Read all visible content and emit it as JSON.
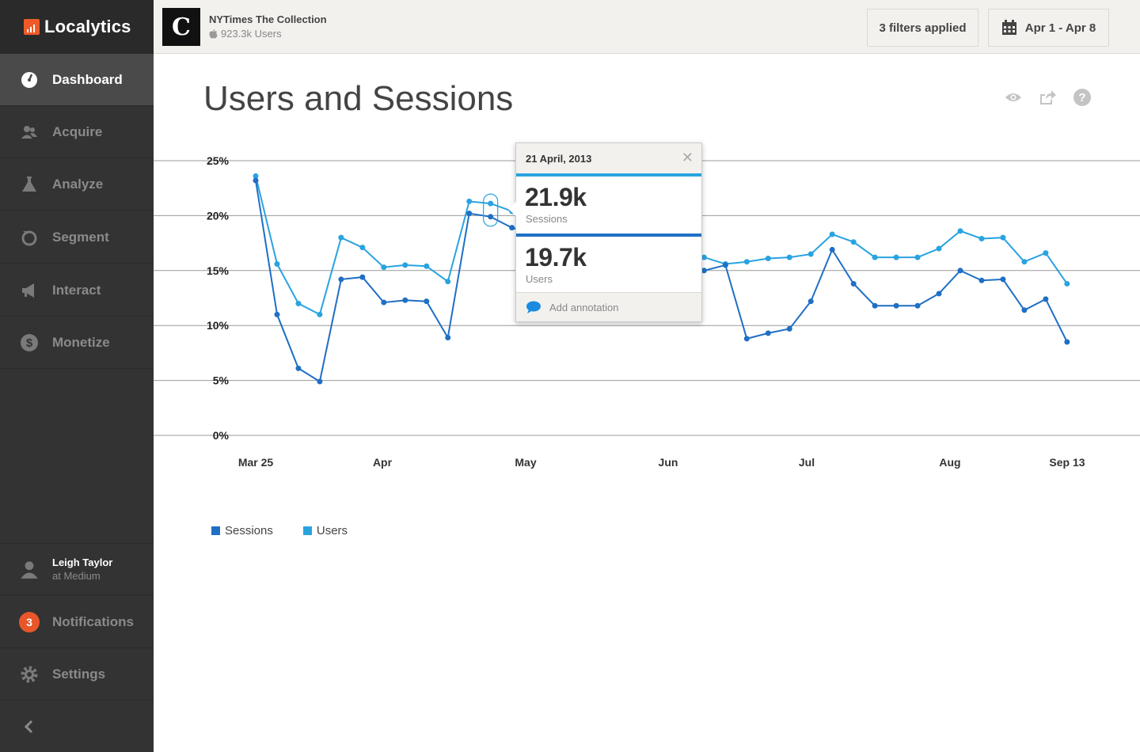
{
  "brand": {
    "name": "Localytics",
    "accent": "#f05a28"
  },
  "sidebar": {
    "items": [
      {
        "label": "Dashboard",
        "icon": "dashboard-gauge-icon",
        "active": true
      },
      {
        "label": "Acquire",
        "icon": "users-icon",
        "active": false
      },
      {
        "label": "Analyze",
        "icon": "flask-icon",
        "active": false
      },
      {
        "label": "Segment",
        "icon": "refresh-circle-icon",
        "active": false
      },
      {
        "label": "Interact",
        "icon": "megaphone-icon",
        "active": false
      },
      {
        "label": "Monetize",
        "icon": "dollar-icon",
        "active": false
      }
    ],
    "user": {
      "name": "Leigh Taylor",
      "org": "at Medium"
    },
    "notifications": {
      "label": "Notifications",
      "count": "3"
    },
    "settings": {
      "label": "Settings"
    },
    "collapse_icon": "chevron-left-icon"
  },
  "topbar": {
    "app_name": "NYTimes The Collection",
    "app_users": "923.3k Users",
    "platform_icon": "apple-icon",
    "filters_label": "3 filters applied",
    "date_range": "Apr 1 - Apr 8"
  },
  "main": {
    "title": "Users and Sessions",
    "header_icons": [
      "eye-icon",
      "share-icon",
      "help-icon"
    ]
  },
  "tooltip": {
    "date": "21 April, 2013",
    "sessions_value": "21.9k",
    "sessions_label": "Sessions",
    "users_value": "19.7k",
    "users_label": "Users",
    "annotation_label": "Add annotation"
  },
  "chart_data": {
    "type": "line",
    "title": "",
    "xlabel": "",
    "ylabel": "",
    "ylim": [
      0,
      25
    ],
    "y_ticks": [
      "0%",
      "5%",
      "10%",
      "15%",
      "20%",
      "25%"
    ],
    "x_tick_labels": [
      "Mar 25",
      "Apr",
      "May",
      "Jun",
      "Jul",
      "Aug",
      "Sep 13"
    ],
    "grid": true,
    "legend_position": "bottom-left",
    "series": [
      {
        "name": "Sessions",
        "color": "#1f6fc5",
        "values": [
          23.2,
          11.0,
          6.1,
          4.9,
          14.2,
          14.4,
          12.1,
          12.3,
          12.2,
          8.9,
          20.2,
          19.9,
          18.9,
          18.3,
          17.5,
          16.8,
          16.2,
          15.8,
          15.5,
          15.4,
          15.2,
          15.0,
          15.5,
          8.8,
          9.3,
          9.7,
          12.2,
          16.9,
          13.8,
          11.8,
          11.8,
          11.8,
          12.9,
          15.0,
          14.1,
          14.2,
          11.4,
          12.4,
          8.5
        ]
      },
      {
        "name": "Users",
        "color": "#29a3e0",
        "values": [
          23.6,
          15.6,
          12.0,
          11.0,
          18.0,
          17.1,
          15.3,
          15.5,
          15.4,
          14.0,
          21.3,
          21.1,
          20.4,
          19.8,
          19.0,
          18.1,
          17.2,
          16.6,
          16.3,
          16.1,
          15.9,
          16.2,
          15.6,
          15.8,
          16.1,
          16.2,
          16.5,
          18.3,
          17.6,
          16.2,
          16.2,
          16.2,
          17.0,
          18.6,
          17.9,
          18.0,
          15.8,
          16.6,
          13.8
        ]
      }
    ]
  }
}
